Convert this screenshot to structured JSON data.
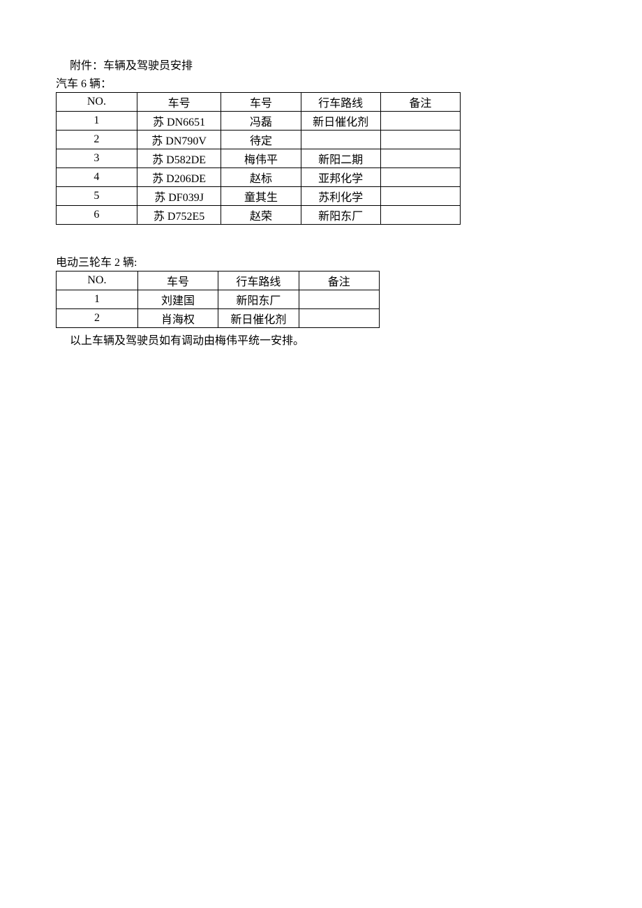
{
  "title": "附件：车辆及驾驶员安排",
  "section1": {
    "subtitle": "汽车 6 辆：",
    "headers": [
      "NO.",
      "车号",
      "车号",
      "行车路线",
      "备注"
    ],
    "rows": [
      {
        "no": "1",
        "plate": "苏 DN6651",
        "driver": "冯磊",
        "route": "新日催化剂",
        "remark": ""
      },
      {
        "no": "2",
        "plate": "苏 DN790V",
        "driver": "待定",
        "route": "",
        "remark": ""
      },
      {
        "no": "3",
        "plate": "苏 D582DE",
        "driver": "梅伟平",
        "route": "新阳二期",
        "remark": ""
      },
      {
        "no": "4",
        "plate": "苏 D206DE",
        "driver": "赵标",
        "route": "亚邦化学",
        "remark": ""
      },
      {
        "no": "5",
        "plate": "苏 DF039J",
        "driver": "童其生",
        "route": "苏利化学",
        "remark": ""
      },
      {
        "no": "6",
        "plate": "苏 D752E5",
        "driver": "赵荣",
        "route": "新阳东厂",
        "remark": ""
      }
    ]
  },
  "section2": {
    "subtitle": "电动三轮车 2 辆:",
    "headers": [
      "NO.",
      "车号",
      "行车路线",
      "备注"
    ],
    "rows": [
      {
        "no": "1",
        "driver": "刘建国",
        "route": "新阳东厂",
        "remark": ""
      },
      {
        "no": "2",
        "driver": "肖海权",
        "route": "新日催化剂",
        "remark": ""
      }
    ]
  },
  "footer": "以上车辆及驾驶员如有调动由梅伟平统一安排。"
}
